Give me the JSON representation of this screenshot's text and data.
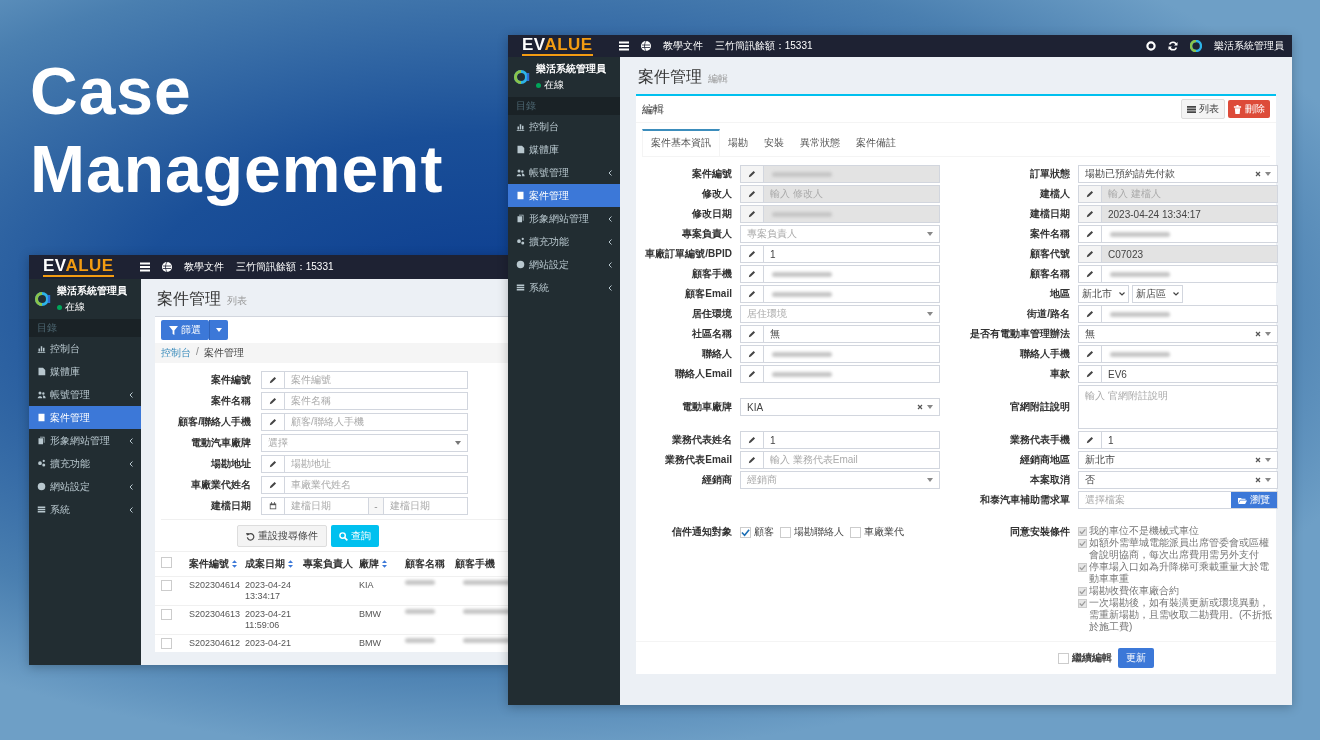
{
  "headline": "Case Management",
  "screens": [
    {
      "kind": "list",
      "logo": {
        "lead": "EV",
        "rest": "ALUE"
      },
      "topbar": {
        "links": [
          "教學文件",
          "三竹簡訊餘額：15331"
        ]
      },
      "user": {
        "name": "樂活系統管理員",
        "status": "在線"
      },
      "nav_header": "目錄",
      "sidebar": {
        "items": [
          {
            "label": "控制台",
            "has_submenu": false,
            "selected": false
          },
          {
            "label": "媒體庫",
            "has_submenu": false,
            "selected": false
          },
          {
            "label": "帳號管理",
            "has_submenu": true,
            "selected": false
          },
          {
            "label": "案件管理",
            "has_submenu": false,
            "selected": true
          },
          {
            "label": "形象網站管理",
            "has_submenu": true,
            "selected": false
          },
          {
            "label": "擴充功能",
            "has_submenu": true,
            "selected": false
          },
          {
            "label": "網站設定",
            "has_submenu": true,
            "selected": false
          },
          {
            "label": "系統",
            "has_submenu": true,
            "selected": false
          }
        ]
      },
      "page": {
        "title": "案件管理",
        "subtitle": "列表"
      },
      "filter_button": "篩選",
      "breadcrumb": {
        "items": [
          "控制台",
          "案件管理"
        ],
        "separator": "/"
      },
      "filters": [
        {
          "label": "案件編號",
          "kind": "text",
          "placeholder": "案件編號"
        },
        {
          "label": "案件名稱",
          "kind": "text",
          "placeholder": "案件名稱"
        },
        {
          "label": "顧客/聯絡人手機",
          "kind": "text",
          "placeholder": "顧客/聯絡人手機"
        },
        {
          "label": "電動汽車廠牌",
          "kind": "select",
          "placeholder": "選擇"
        },
        {
          "label": "場勘地址",
          "kind": "text",
          "placeholder": "場勘地址"
        },
        {
          "label": "車廠業代姓名",
          "kind": "text",
          "placeholder": "車廠業代姓名"
        },
        {
          "label": "建檔日期",
          "kind": "daterange",
          "placeholder": "建檔日期",
          "placeholder_end": "建檔日期",
          "separator": "-"
        }
      ],
      "reset_button": "重設搜尋條件",
      "search_button": "查詢",
      "table": {
        "select_all_checked": false,
        "columns": [
          {
            "label": "案件編號",
            "sortable": true
          },
          {
            "label": "成案日期",
            "sortable": true
          },
          {
            "label": "專案負責人",
            "sortable": false
          },
          {
            "label": "廠牌",
            "sortable": true
          },
          {
            "label": "顧客名稱",
            "sortable": false
          },
          {
            "label": "顧客手機",
            "sortable": false
          }
        ],
        "rows": [
          {
            "checked": false,
            "case_no": "S202304614",
            "date": "2023-04-24",
            "time": "13:34:17",
            "brand": "KIA",
            "redacted": true
          },
          {
            "checked": false,
            "case_no": "S202304613",
            "date": "2023-04-21",
            "time": "11:59:06",
            "brand": "BMW",
            "redacted": true
          },
          {
            "checked": false,
            "case_no": "S202304612",
            "date": "2023-04-21",
            "brand": "BMW",
            "redacted": true
          }
        ]
      }
    },
    {
      "kind": "edit",
      "logo": {
        "lead": "EV",
        "rest": "ALUE"
      },
      "topbar": {
        "links": [
          "教學文件",
          "三竹簡訊餘額：15331"
        ],
        "account": "樂活系統管理員"
      },
      "user": {
        "name": "樂活系統管理員",
        "status": "在線"
      },
      "nav_header": "目錄",
      "sidebar": {
        "items": [
          {
            "label": "控制台",
            "has_submenu": false,
            "selected": false
          },
          {
            "label": "媒體庫",
            "has_submenu": false,
            "selected": false
          },
          {
            "label": "帳號管理",
            "has_submenu": true,
            "selected": false
          },
          {
            "label": "案件管理",
            "has_submenu": false,
            "selected": true
          },
          {
            "label": "形象網站管理",
            "has_submenu": true,
            "selected": false
          },
          {
            "label": "擴充功能",
            "has_submenu": true,
            "selected": false
          },
          {
            "label": "網站設定",
            "has_submenu": true,
            "selected": false
          },
          {
            "label": "系統",
            "has_submenu": true,
            "selected": false
          }
        ]
      },
      "page": {
        "title": "案件管理",
        "subtitle": "編輯"
      },
      "box": {
        "title": "編輯",
        "list_button": "列表",
        "delete_button": "刪除"
      },
      "tabs": [
        {
          "label": "案件基本資訊",
          "selected": true
        },
        {
          "label": "場勘",
          "selected": false
        },
        {
          "label": "安裝",
          "selected": false
        },
        {
          "label": "異常狀態",
          "selected": false
        },
        {
          "label": "案件備註",
          "selected": false
        }
      ],
      "form": {
        "rows": [
          {
            "left": {
              "label": "案件編號",
              "kind": "text",
              "readonly": true,
              "redacted": true
            },
            "right": {
              "label": "訂單狀態",
              "kind": "select",
              "value": "場勘已預約請先付款",
              "clearable": true
            }
          },
          {
            "left": {
              "label": "修改人",
              "kind": "text",
              "readonly": true,
              "placeholder": "輸入 修改人"
            },
            "right": {
              "label": "建檔人",
              "kind": "text",
              "readonly": true,
              "placeholder": "輸入 建檔人"
            }
          },
          {
            "left": {
              "label": "修改日期",
              "kind": "text",
              "readonly": true,
              "redacted": true
            },
            "right": {
              "label": "建檔日期",
              "kind": "text",
              "readonly": true,
              "value": "2023-04-24 13:34:17"
            }
          },
          {
            "left": {
              "label": "專案負責人",
              "kind": "select",
              "placeholder": "專案負責人",
              "clearable": false
            },
            "right": {
              "label": "案件名稱",
              "kind": "text",
              "readonly": false,
              "redacted": true
            }
          },
          {
            "left": {
              "label": "車廠訂單編號/BPID",
              "kind": "text",
              "readonly": false,
              "value": "1"
            },
            "right": {
              "label": "顧客代號",
              "kind": "text",
              "readonly": true,
              "value": "C07023"
            }
          },
          {
            "left": {
              "label": "顧客手機",
              "kind": "text",
              "readonly": false,
              "redacted": true
            },
            "right": {
              "label": "顧客名稱",
              "kind": "text",
              "readonly": false,
              "redacted": true
            }
          },
          {
            "left": {
              "label": "顧客Email",
              "kind": "text",
              "readonly": false,
              "redacted": true
            },
            "right": {
              "label": "地區",
              "kind": "region",
              "values": [
                "新北市",
                "新店區"
              ]
            }
          },
          {
            "left": {
              "label": "居住環境",
              "kind": "select",
              "placeholder": "居住環境",
              "clearable": false
            },
            "right": {
              "label": "街道/路名",
              "kind": "text",
              "readonly": false,
              "redacted": true
            }
          },
          {
            "left": {
              "label": "社區名稱",
              "kind": "text",
              "readonly": false,
              "value": "無"
            },
            "right": {
              "label": "是否有電動車管理辦法",
              "kind": "select",
              "value": "無",
              "clearable": true
            }
          },
          {
            "left": {
              "label": "聯絡人",
              "kind": "text",
              "readonly": false,
              "redacted": true
            },
            "right": {
              "label": "聯絡人手機",
              "kind": "text",
              "readonly": false,
              "redacted": true
            }
          },
          {
            "left": {
              "label": "聯絡人Email",
              "kind": "text",
              "readonly": false,
              "redacted": true
            },
            "right": {
              "label": "車款",
              "kind": "text",
              "readonly": false,
              "value": "EV6"
            }
          },
          {
            "left": {
              "label": "電動車廠牌",
              "kind": "select",
              "value": "KIA",
              "clearable": true
            },
            "right": {
              "label": "官網附註說明",
              "kind": "textarea",
              "placeholder": "輸入 官網附註說明"
            }
          },
          {
            "left": {
              "label": "業務代表姓名",
              "kind": "text",
              "readonly": false,
              "value": "1"
            },
            "right": {
              "label": "業務代表手機",
              "kind": "text",
              "readonly": false,
              "value": "1"
            }
          },
          {
            "left": {
              "label": "業務代表Email",
              "kind": "text",
              "readonly": false,
              "placeholder": "輸入 業務代表Email"
            },
            "right": {
              "label": "經銷商地區",
              "kind": "select",
              "value": "新北市",
              "clearable": true
            }
          },
          {
            "left": {
              "label": "經銷商",
              "kind": "select",
              "placeholder": "經銷商",
              "clearable": false
            },
            "right": {
              "label": "本案取消",
              "kind": "select",
              "value": "否",
              "clearable": true
            }
          },
          {
            "right": {
              "label": "和泰汽車補助需求單",
              "kind": "file",
              "placeholder": "選擇檔案",
              "button": "瀏覽"
            }
          },
          {
            "left": {
              "label": "信件通知對象",
              "kind": "checkboxes",
              "options": [
                {
                  "label": "顧客",
                  "checked": true
                },
                {
                  "label": "場勘聯絡人",
                  "checked": false
                },
                {
                  "label": "車廠業代",
                  "checked": false
                }
              ]
            },
            "right": {
              "label": "同意安裝條件",
              "kind": "terms",
              "disabled": true,
              "items": [
                {
                  "text": "我的車位不是機械式車位",
                  "checked": true
                },
                {
                  "text": "如額外需華城電能派員出席管委會或區權會說明協商，每次出席費用需另外支付",
                  "checked": true
                },
                {
                  "text": "停車場入口如為升降梯可乘載重量大於電動車車重",
                  "checked": true
                },
                {
                  "text": "場勘收費依車廠合約",
                  "checked": true
                },
                {
                  "text": "一次場勘後，如有裝潢更新或環境異動，需重新場勘，且需收取二勘費用。(不折抵於施工費)",
                  "checked": true
                }
              ]
            }
          }
        ]
      },
      "footer": {
        "continue": {
          "label": "繼續編輯",
          "checked": false
        },
        "submit": "更新"
      }
    }
  ]
}
